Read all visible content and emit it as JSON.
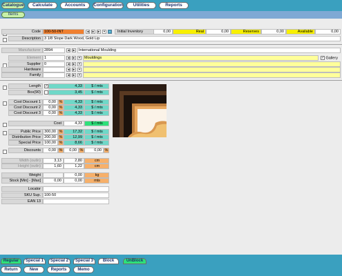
{
  "nav_tabs": [
    "Catalogue",
    "Calculate",
    "Accounts",
    "Configuration",
    "Utilities",
    "Reports"
  ],
  "sub_tab": "Items",
  "labels": {
    "code": "Code",
    "description": "Description",
    "initial_inventory": "Initial Inventory",
    "real": "Real",
    "reserves": "Reserves",
    "available": "Available",
    "manufacturer": "Manufacturer",
    "element": "Element",
    "supplier": "Supplier",
    "hardware": "Hardware",
    "family": "Family",
    "gallery": "Gallery",
    "length": "Length",
    "box": "Box(90)",
    "cost_discount_1": "Cost Discount 1",
    "cost_discount_2": "Cost Discount 2",
    "cost_discount_3": "Cost Discount 3",
    "cost": "Cost",
    "public_price": "Public Price",
    "distribution_price": "Distribution Price",
    "special_price": "Special Price",
    "discounts": "Discounts",
    "width": "Width (outln)",
    "height": "Height (outln)",
    "weight": "Weight",
    "stock": "Stock [Min] - [Max]",
    "locator": "Locator",
    "sku_sup": "SKU Sup.",
    "ean13": "EAN 13"
  },
  "values": {
    "code": "100-50-INT",
    "description": "3 1/8  Slope Dark Wood, Gold Lip",
    "initial_inventory": "0,00",
    "real": "0,00",
    "reserves": "0,00",
    "available": "0,00",
    "manufacturer_code": "2894",
    "manufacturer_name": "International Moulding",
    "element_code": "1",
    "element_name": "Mouldings",
    "supplier_code": "0",
    "length_pct": "",
    "length_val": "4,33",
    "length_unit": "$ / mts",
    "box_val": "3,45",
    "box_unit": "$ / mts",
    "cd1_pct": "0,00",
    "cd1_sym": "%",
    "cd1_val": "4,33",
    "cd1_unit": "$ / mts",
    "cd2_pct": "0,00",
    "cd2_sym": "%",
    "cd2_val": "4,33",
    "cd2_unit": "$ / mts",
    "cd3_pct": "0,00",
    "cd3_sym": "%",
    "cd3_val": "4,33",
    "cd3_unit": "$ / mts",
    "cost_val": "4,33",
    "cost_unit": "$ / mts",
    "public_pct": "300,00",
    "public_sym": "%",
    "public_val": "17,32",
    "public_unit": "$ / mts",
    "dist_pct": "200,00",
    "dist_sym": "%",
    "dist_val": "12,99",
    "dist_unit": "$ / mts",
    "special_pct": "100,00",
    "special_sym": "%",
    "special_val": "8,66",
    "special_unit": "$ / mts",
    "disc_1": "0,00",
    "disc_1s": "%",
    "disc_2": "0,00",
    "disc_2s": "%",
    "disc_3": "0,00",
    "disc_3s": "%",
    "width_1": "3,13",
    "width_2": "2,80",
    "width_unit": "cm",
    "height_1": "1,60",
    "height_2": "1,22",
    "height_unit": "cm",
    "weight_val": "0,00",
    "weight_unit": "kg",
    "stock_min": "0,00",
    "stock_max": "0,00",
    "stock_unit": "mts",
    "sku_sup": "100-50"
  },
  "bottom_tabs": [
    "Regular",
    "Special 1",
    "Special 2",
    "Special 3",
    "Block",
    "UnBlock"
  ],
  "bottom_buttons": [
    "Return",
    "New",
    "Reports",
    "Memo"
  ]
}
